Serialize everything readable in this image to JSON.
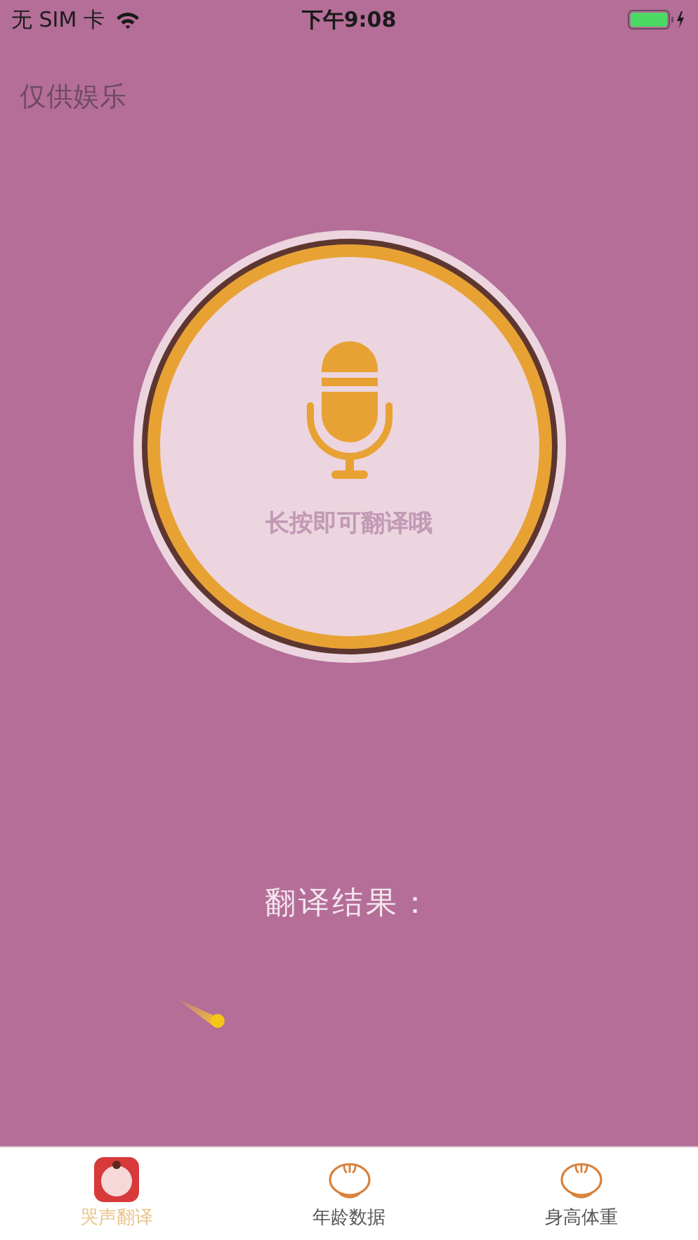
{
  "status_bar": {
    "carrier": "无 SIM 卡",
    "time": "下午9:08"
  },
  "header": {
    "note": "仅供娱乐"
  },
  "record_button": {
    "hint": "长按即可翻译哦"
  },
  "result": {
    "title": "翻译结果："
  },
  "tabs": [
    {
      "label": "哭声翻译",
      "kind": "app",
      "selected": true
    },
    {
      "label": "年龄数据",
      "kind": "baby",
      "selected": false
    },
    {
      "label": "身高体重",
      "kind": "baby",
      "selected": false
    }
  ]
}
